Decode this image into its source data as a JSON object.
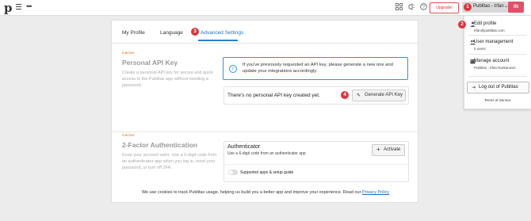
{
  "topbar": {
    "logo": "p",
    "upgrade_label": "Upgrade!",
    "user_label": "Publitas - Irfan",
    "avatar_initials": "IN"
  },
  "tabs": [
    {
      "label": "My Profile"
    },
    {
      "label": "Language"
    },
    {
      "label": "Advanced Settings"
    }
  ],
  "steps": {
    "one": "1",
    "two": "2",
    "three": "3",
    "four": "4"
  },
  "api_key": {
    "status": "Inactive",
    "title": "Personal API Key",
    "description": "Create a personal API key for secure and quick access to the Publitas app without needing a password.",
    "info": "If you've previously requested an API key, please generate a new one and update your integrations accordingly.",
    "empty_text": "There's no personal API key created yet.",
    "generate_label": "Generate API Key"
  },
  "two_fa": {
    "status": "Inactive",
    "title": "2-Factor Authentication",
    "description": "Keep your account safer. Use a 6-digit code from an authenticator app when you log in, reset your password, or turn off 2FA.",
    "authenticator_title": "Authenticator",
    "authenticator_sub": "Use a 6-digit code from an authenticator app",
    "activate_label": "Activate",
    "guide_label": "Supported apps & setup guide"
  },
  "cookie": {
    "text": "We use cookies to track Publitas usage, helping us build you a better app and improve your experience. Read our",
    "link": "Privacy Policy"
  },
  "dropdown": {
    "edit_title": "Edit profile",
    "edit_sub": "irfan@publitas.com",
    "users_title": "User management",
    "users_sub": "5 users",
    "account_title": "Manage account",
    "account_sub": "Publitas - Irfan Nurkanovic",
    "logout_label": "Log out of Publitas",
    "tos_label": "Terms of Service"
  },
  "colors": {
    "accent": "#1a73c8",
    "step_badge": "#d9363e",
    "inactive": "#e07a1a",
    "avatar": "#e0506a"
  }
}
